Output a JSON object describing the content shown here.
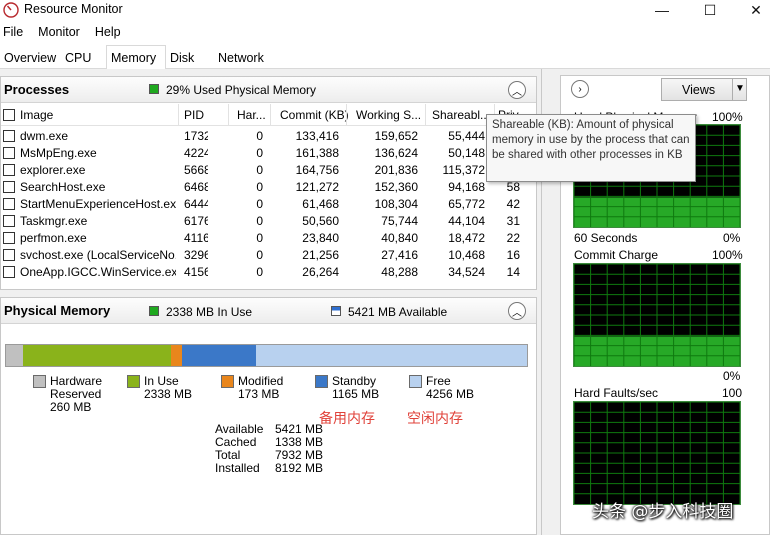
{
  "window": {
    "title": "Resource Monitor",
    "minimize_glyph": "—",
    "maximize_glyph": "☐",
    "close_glyph": "✕"
  },
  "menu": [
    "File",
    "Monitor",
    "Help"
  ],
  "tabs": [
    "Overview",
    "CPU",
    "Memory",
    "Disk",
    "Network"
  ],
  "active_tab": "Memory",
  "processes": {
    "title": "Processes",
    "summary": "29% Used Physical Memory",
    "columns": [
      "Image",
      "PID",
      "Har...",
      "Commit (KB)",
      "Working S...",
      "Shareabl...",
      "Priv"
    ],
    "rows": [
      {
        "image": "dwm.exe",
        "pid": "1732",
        "hard": "0",
        "commit": "133,416",
        "working": "159,652",
        "shareable": "55,444",
        "private": ""
      },
      {
        "image": "MsMpEng.exe",
        "pid": "4224",
        "hard": "0",
        "commit": "161,388",
        "working": "136,624",
        "shareable": "50,148",
        "private": ""
      },
      {
        "image": "explorer.exe",
        "pid": "5668",
        "hard": "0",
        "commit": "164,756",
        "working": "201,836",
        "shareable": "115,372",
        "private": ""
      },
      {
        "image": "SearchHost.exe",
        "pid": "6468",
        "hard": "0",
        "commit": "121,272",
        "working": "152,360",
        "shareable": "94,168",
        "private": "58"
      },
      {
        "image": "StartMenuExperienceHost.exe",
        "pid": "6444",
        "hard": "0",
        "commit": "61,468",
        "working": "108,304",
        "shareable": "65,772",
        "private": "42"
      },
      {
        "image": "Taskmgr.exe",
        "pid": "6176",
        "hard": "0",
        "commit": "50,560",
        "working": "75,744",
        "shareable": "44,104",
        "private": "31"
      },
      {
        "image": "perfmon.exe",
        "pid": "4116",
        "hard": "0",
        "commit": "23,840",
        "working": "40,840",
        "shareable": "18,472",
        "private": "22"
      },
      {
        "image": "svchost.exe (LocalServiceNo...",
        "pid": "3296",
        "hard": "0",
        "commit": "21,256",
        "working": "27,416",
        "shareable": "10,468",
        "private": "16"
      },
      {
        "image": "OneApp.IGCC.WinService.exe",
        "pid": "4156",
        "hard": "0",
        "commit": "26,264",
        "working": "48,288",
        "shareable": "34,524",
        "private": "14"
      }
    ]
  },
  "tooltip": {
    "text": "Shareable (KB): Amount of physical memory in use by the process that can be shared with other processes in KB"
  },
  "physical_memory": {
    "title": "Physical Memory",
    "in_use_summary": "2338 MB In Use",
    "available_summary": "5421 MB Available",
    "bar_mb": {
      "hardware_reserved": 260,
      "in_use": 2338,
      "modified": 173,
      "standby": 1165,
      "free": 4256
    },
    "legend": [
      {
        "name": "Hardware Reserved",
        "value": "260 MB",
        "color": "#c0c0c0"
      },
      {
        "name": "In Use",
        "value": "2338 MB",
        "color": "#8ab31b"
      },
      {
        "name": "Modified",
        "value": "173 MB",
        "color": "#e9861c"
      },
      {
        "name": "Standby",
        "value": "1165 MB",
        "color": "#3b78c8"
      },
      {
        "name": "Free",
        "value": "4256 MB",
        "color": "#b8d1ef"
      }
    ],
    "legend_label_1a": "Hardware",
    "legend_label_1b": "Reserved",
    "stats": [
      {
        "label": "Available",
        "value": "5421 MB"
      },
      {
        "label": "Cached",
        "value": "1338 MB"
      },
      {
        "label": "Total",
        "value": "7932 MB"
      },
      {
        "label": "Installed",
        "value": "8192 MB"
      }
    ],
    "annotation_standby": "备用内存",
    "annotation_free": "空闲内存"
  },
  "right_pane": {
    "views_label": "Views",
    "graphs": [
      {
        "title": "Used Physical Memory",
        "max": "100%",
        "bottom_left": "60 Seconds",
        "bottom_right": "0%",
        "level_percent": 29
      },
      {
        "title": "Commit Charge",
        "max": "100%",
        "bottom_left": "",
        "bottom_right": "0%",
        "level_percent": 29
      },
      {
        "title": "Hard Faults/sec",
        "max": "100",
        "bottom_left": "",
        "bottom_right": "",
        "level_percent": 0
      }
    ]
  },
  "watermark": "头条 @步入科技圈",
  "colors": {
    "graph_fill": "#27a927",
    "graph_grid": "#0f7a0f",
    "summary_green": "#1fa91f",
    "summary_blue": "#2f6fd0"
  }
}
